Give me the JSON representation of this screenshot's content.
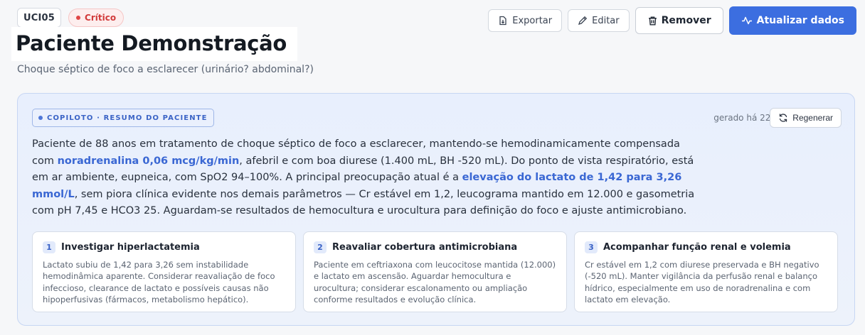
{
  "patient": {
    "unit": "UCI05",
    "status": "Crítico",
    "name": "Paciente Demonstração",
    "diagnosis": "Choque séptico de foco a esclarecer (urinário? abdominal?)"
  },
  "actions": {
    "export": "Exportar",
    "edit": "Editar",
    "remove": "Remover",
    "refresh": "Atualizar dados"
  },
  "copilot": {
    "tag": "COPILOTO · RESUMO DO PACIENTE",
    "generated": "gerado há 22h",
    "regenerate": "Regenerar",
    "summary": {
      "p1": "Paciente de 88 anos em tratamento de choque séptico de foco a esclarecer, mantendo-se hemodinamicamente compensada com ",
      "h1": "noradrenalina 0,06 mcg/kg/min",
      "p2": ", afebril e com boa diurese (1.400 mL, BH -520 mL). Do ponto de vista respiratório, está em ar ambiente, eupneica, com SpO2 94–100%. A principal preocupação atual é a ",
      "h2": "elevação do lactato de 1,42 para 3,26 mmol/L",
      "p3": ", sem piora clínica evidente nos demais parâmetros — Cr estável em 1,2, leucograma mantido em 12.000 e gasometria com pH 7,45 e HCO3 25. Aguardam-se resultados de hemocultura e urocultura para definição do foco e ajuste antimicrobiano."
    },
    "recommendations": [
      {
        "num": "1",
        "title": "Investigar hiperlactatemia",
        "text": "Lactato subiu de 1,42 para 3,26 sem instabilidade hemodinâmica aparente. Considerar reavaliação de foco infeccioso, clearance de lactato e possíveis causas não hipoperfusivas (fármacos, metabolismo hepático)."
      },
      {
        "num": "2",
        "title": "Reavaliar cobertura antimicrobiana",
        "text": "Paciente em ceftriaxona com leucocitose mantida (12.000) e lactato em ascensão. Aguardar hemocultura e urocultura; considerar escalonamento ou ampliação conforme resultados e evolução clínica."
      },
      {
        "num": "3",
        "title": "Acompanhar função renal e volemia",
        "text": "Cr estável em 1,2 com diurese preservada e BH negativo (-520 mL). Manter vigilância da perfusão renal e balanço hídrico, especialmente em uso de noradrenalina e com lactato em elevação."
      }
    ]
  },
  "colors": {
    "accent": "#3c6ee0",
    "critical": "#d23b3b",
    "highlight": "#3a67d3",
    "card_bg": "#e8effd"
  },
  "icons": {
    "export": "file-export-icon",
    "edit": "pencil-icon",
    "remove": "trash-icon",
    "refresh": "pulse-icon",
    "regenerate": "refresh-icon"
  }
}
